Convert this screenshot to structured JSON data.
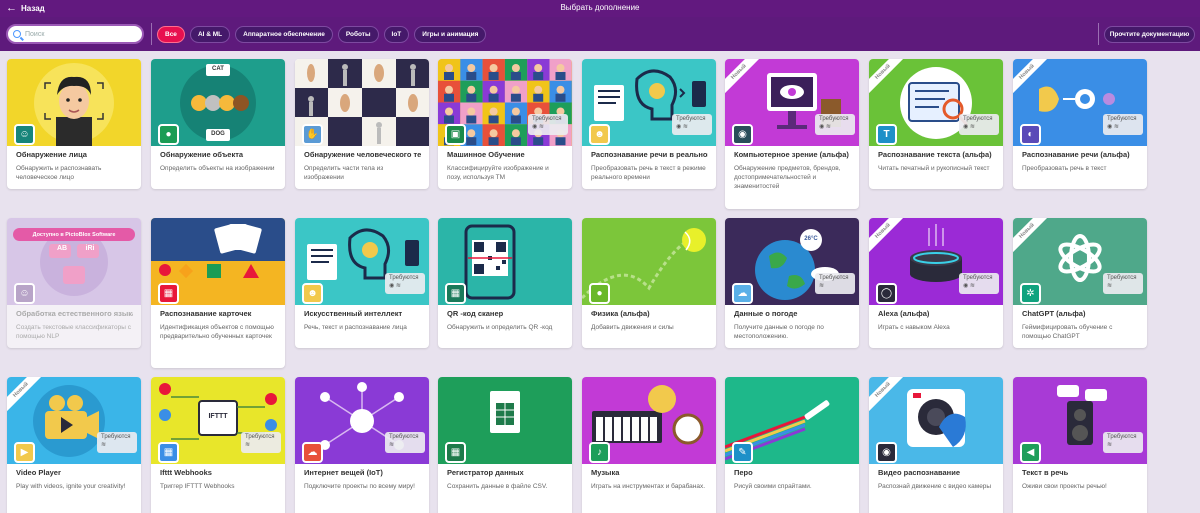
{
  "topbar": {
    "back_label": "Назад",
    "title": "Выбрать дополнение"
  },
  "search": {
    "placeholder": "Поиск"
  },
  "filters": [
    "Все",
    "AI & ML",
    "Аппаратное обеспечение",
    "Роботы",
    "IoT",
    "Игры и анимация"
  ],
  "docs_button": "Прочтите документацию",
  "card_labels": {
    "new": "Новый",
    "requires": "Требуются",
    "pictoblox_banner": "Доступно в PictoBlox Software"
  },
  "cards": [
    {
      "title": "Обнаружение лица",
      "desc": "Обнаружить и распознавать человеческое лицо"
    },
    {
      "title": "Обнаружение объекта",
      "desc": "Определить объекты на изображении"
    },
    {
      "title": "Обнаружение человеческого тела",
      "desc": "Определить части тела из изображении"
    },
    {
      "title": "Машинное Обучение",
      "desc": "Классифицируйте изображение и позу, используя TM"
    },
    {
      "title": "Распознавание речи в реальном вр",
      "desc": "Преобразовать речь в текст в режиме реального времени"
    },
    {
      "title": "Компьютерное зрение (альфа)",
      "desc": "Обнаружение предметов, брендов, достопримечательностей и знаменитостей"
    },
    {
      "title": "Распознавание текста (альфа)",
      "desc": "Читать печатный и рукописный текст"
    },
    {
      "title": "Распознавание речи (альфа)",
      "desc": "Преобразовать речь в текст"
    },
    {
      "title": "Обработка естественного языка",
      "desc": "Создать текстовые классификаторы с помощью NLP"
    },
    {
      "title": "Распознавание карточек",
      "desc": "Идентификация объектов с помощью предварительно обученных карточек"
    },
    {
      "title": "Искусственный интеллект",
      "desc": "Речь, текст и распознавание лица"
    },
    {
      "title": "QR -код сканер",
      "desc": "Обнаружить и определить QR -код"
    },
    {
      "title": "Физика (альфа)",
      "desc": "Добавить движения и силы"
    },
    {
      "title": "Данные о погоде",
      "desc": "Получите данные о погоде по местоположению."
    },
    {
      "title": "Alexa (альфа)",
      "desc": "Играть с навыком Alexa"
    },
    {
      "title": "ChatGPT (альфа)",
      "desc": "Геймифицировать обучение с помощью ChatGPT"
    },
    {
      "title": "Video Player",
      "desc": "Play with videos, ignite your creativity!"
    },
    {
      "title": "Ifttt Webhooks",
      "desc": "Триггер IFTTT Webhooks"
    },
    {
      "title": "Интернет вещей (IoT)",
      "desc": "Подключите проекты по всему миру!"
    },
    {
      "title": "Регистратор данных",
      "desc": "Сохранить данные в файле CSV."
    },
    {
      "title": "Музыка",
      "desc": "Играть на инструментах и барабанах."
    },
    {
      "title": "Перо",
      "desc": "Рисуй своими спрайтами."
    },
    {
      "title": "Видео распознавание",
      "desc": "Распознай движение с видео камеры"
    },
    {
      "title": "Текст в речь",
      "desc": "Оживи свои проекты речью!"
    }
  ],
  "art_text": {
    "cat": "CAT",
    "dog": "DOG",
    "ab": "AB",
    "iri": "iRi",
    "ifttt": "IFTTT",
    "temp": "26°C"
  },
  "colors": {
    "topbar": "#62197f",
    "filterbar": "#5e1a7c",
    "active_chip": "#e8104f",
    "background": "#e8e2ee"
  }
}
